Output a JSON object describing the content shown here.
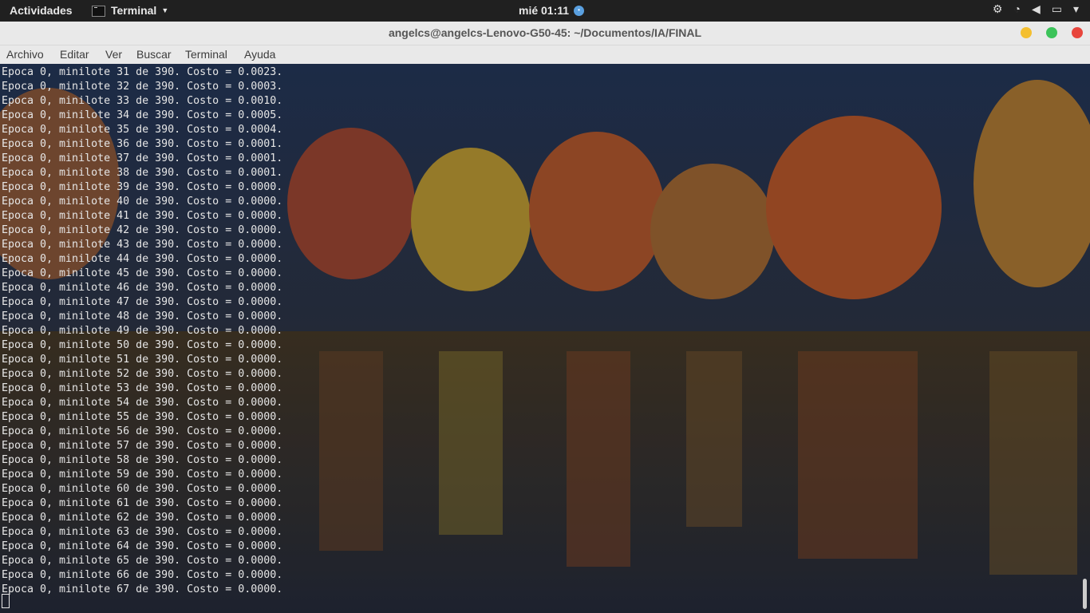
{
  "topbar": {
    "activities": "Actividades",
    "app_name": "Terminal",
    "clock": "mié 01:11",
    "tray_icons": [
      "accessibility-icon",
      "wifi-icon",
      "volume-icon",
      "battery-icon",
      "power-menu-caret-icon"
    ]
  },
  "window": {
    "title": "angelcs@angelcs-Lenovo-G50-45: ~/Documentos/IA/FINAL"
  },
  "menu": {
    "archivo": "Archivo",
    "editar": "Editar",
    "ver": "Ver",
    "buscar": "Buscar",
    "terminal": "Terminal",
    "ayuda": "Ayuda"
  },
  "terminal": {
    "lines": [
      "Epoca 0, minilote 31 de 390. Costo = 0.0023.",
      "Epoca 0, minilote 32 de 390. Costo = 0.0003.",
      "Epoca 0, minilote 33 de 390. Costo = 0.0010.",
      "Epoca 0, minilote 34 de 390. Costo = 0.0005.",
      "Epoca 0, minilote 35 de 390. Costo = 0.0004.",
      "Epoca 0, minilote 36 de 390. Costo = 0.0001.",
      "Epoca 0, minilote 37 de 390. Costo = 0.0001.",
      "Epoca 0, minilote 38 de 390. Costo = 0.0001.",
      "Epoca 0, minilote 39 de 390. Costo = 0.0000.",
      "Epoca 0, minilote 40 de 390. Costo = 0.0000.",
      "Epoca 0, minilote 41 de 390. Costo = 0.0000.",
      "Epoca 0, minilote 42 de 390. Costo = 0.0000.",
      "Epoca 0, minilote 43 de 390. Costo = 0.0000.",
      "Epoca 0, minilote 44 de 390. Costo = 0.0000.",
      "Epoca 0, minilote 45 de 390. Costo = 0.0000.",
      "Epoca 0, minilote 46 de 390. Costo = 0.0000.",
      "Epoca 0, minilote 47 de 390. Costo = 0.0000.",
      "Epoca 0, minilote 48 de 390. Costo = 0.0000.",
      "Epoca 0, minilote 49 de 390. Costo = 0.0000.",
      "Epoca 0, minilote 50 de 390. Costo = 0.0000.",
      "Epoca 0, minilote 51 de 390. Costo = 0.0000.",
      "Epoca 0, minilote 52 de 390. Costo = 0.0000.",
      "Epoca 0, minilote 53 de 390. Costo = 0.0000.",
      "Epoca 0, minilote 54 de 390. Costo = 0.0000.",
      "Epoca 0, minilote 55 de 390. Costo = 0.0000.",
      "Epoca 0, minilote 56 de 390. Costo = 0.0000.",
      "Epoca 0, minilote 57 de 390. Costo = 0.0000.",
      "Epoca 0, minilote 58 de 390. Costo = 0.0000.",
      "Epoca 0, minilote 59 de 390. Costo = 0.0000.",
      "Epoca 0, minilote 60 de 390. Costo = 0.0000.",
      "Epoca 0, minilote 61 de 390. Costo = 0.0000.",
      "Epoca 0, minilote 62 de 390. Costo = 0.0000.",
      "Epoca 0, minilote 63 de 390. Costo = 0.0000.",
      "Epoca 0, minilote 64 de 390. Costo = 0.0000.",
      "Epoca 0, minilote 65 de 390. Costo = 0.0000.",
      "Epoca 0, minilote 66 de 390. Costo = 0.0000.",
      "Epoca 0, minilote 67 de 390. Costo = 0.0000."
    ]
  },
  "colors": {
    "topbar_bg": "#202020",
    "headerbar_bg": "#e9e9e9",
    "terminal_text": "#e6e6e6",
    "btn_close": "#e8453c",
    "btn_min": "#f4bf30",
    "btn_max": "#3cc35a"
  }
}
